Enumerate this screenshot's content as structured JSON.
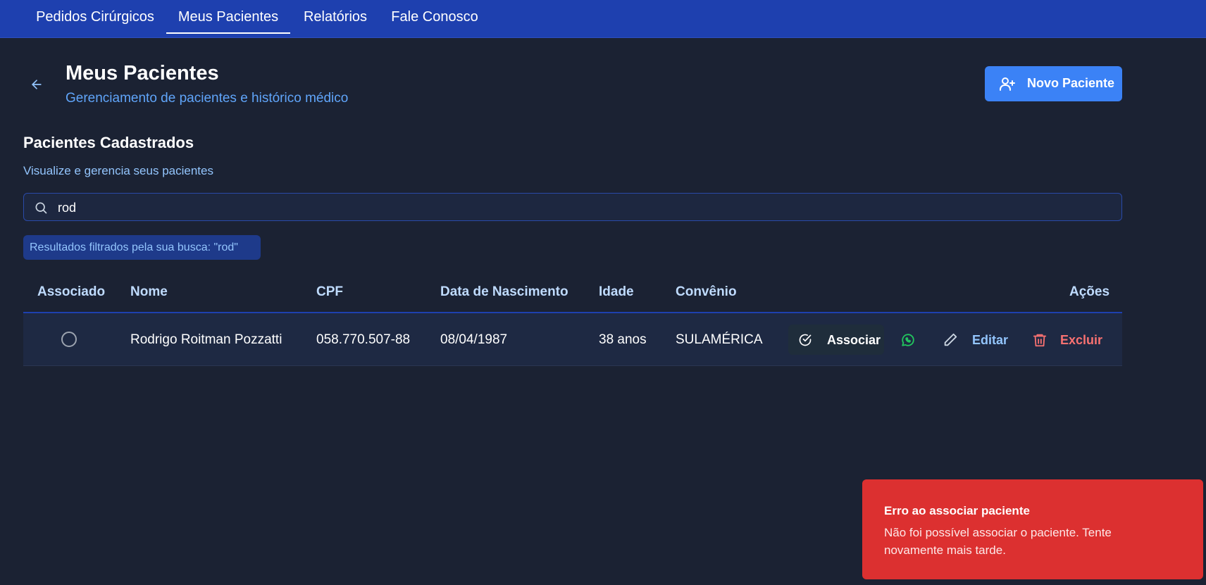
{
  "nav": {
    "tabs": [
      {
        "label": "Pedidos Cirúrgicos"
      },
      {
        "label": "Meus Pacientes",
        "active": true
      },
      {
        "label": "Relatórios"
      },
      {
        "label": "Fale Conosco"
      }
    ]
  },
  "header": {
    "title": "Meus Pacientes",
    "subtitle": "Gerenciamento de pacientes e histórico médico",
    "new_button_label": "Novo Paciente"
  },
  "section": {
    "title": "Pacientes Cadastrados",
    "subtitle": "Visualize e gerencia seus pacientes"
  },
  "search": {
    "value": "rod",
    "filter_notice": "Resultados filtrados pela sua busca: \"rod\""
  },
  "table": {
    "columns": [
      "Associado",
      "Nome",
      "CPF",
      "Data de Nascimento",
      "Idade",
      "Convênio",
      "Ações"
    ],
    "rows": [
      {
        "associated": false,
        "nome": "Rodrigo Roitman Pozzatti",
        "cpf": "058.770.507-88",
        "nascimento": "08/04/1987",
        "idade": "38 anos",
        "convenio": "SULAMÉRICA",
        "actions": {
          "associar": "Associar",
          "editar": "Editar",
          "excluir": "Excluir"
        }
      }
    ]
  },
  "toast": {
    "title": "Erro ao associar paciente",
    "message": "Não foi possível associar o paciente. Tente novamente mais tarde."
  },
  "colors": {
    "background": "#1b2233",
    "nav": "#1e40af",
    "primary": "#3b82f6",
    "accent_text": "#60a5fa",
    "danger": "#dc3030",
    "whatsapp": "#22c55e"
  },
  "icons": {
    "back": "arrow-left-icon",
    "new_patient": "user-plus-icon",
    "search": "search-icon",
    "associar": "check-circle-icon",
    "whatsapp": "whatsapp-icon",
    "edit": "pencil-icon",
    "delete": "trash-icon"
  }
}
